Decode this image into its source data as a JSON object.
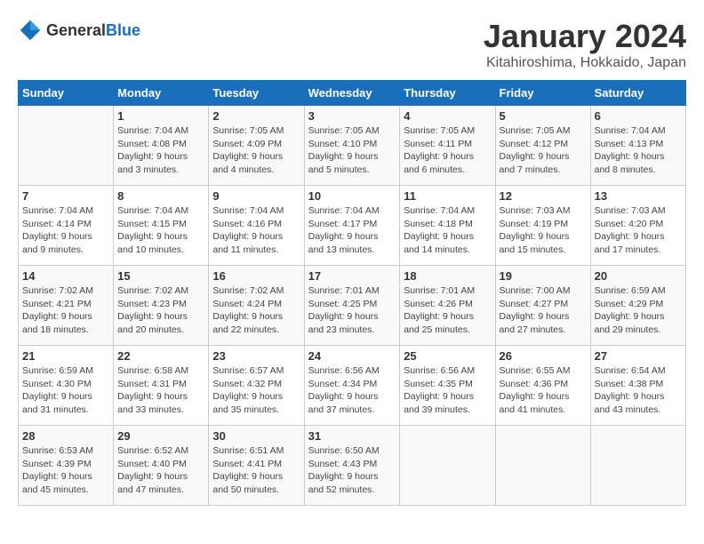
{
  "logo": {
    "general": "General",
    "blue": "Blue"
  },
  "header": {
    "month": "January 2024",
    "location": "Kitahiroshima, Hokkaido, Japan"
  },
  "weekdays": [
    "Sunday",
    "Monday",
    "Tuesday",
    "Wednesday",
    "Thursday",
    "Friday",
    "Saturday"
  ],
  "weeks": [
    [
      {
        "day": "",
        "sunrise": "",
        "sunset": "",
        "daylight": ""
      },
      {
        "day": "1",
        "sunrise": "Sunrise: 7:04 AM",
        "sunset": "Sunset: 4:08 PM",
        "daylight": "Daylight: 9 hours and 3 minutes."
      },
      {
        "day": "2",
        "sunrise": "Sunrise: 7:05 AM",
        "sunset": "Sunset: 4:09 PM",
        "daylight": "Daylight: 9 hours and 4 minutes."
      },
      {
        "day": "3",
        "sunrise": "Sunrise: 7:05 AM",
        "sunset": "Sunset: 4:10 PM",
        "daylight": "Daylight: 9 hours and 5 minutes."
      },
      {
        "day": "4",
        "sunrise": "Sunrise: 7:05 AM",
        "sunset": "Sunset: 4:11 PM",
        "daylight": "Daylight: 9 hours and 6 minutes."
      },
      {
        "day": "5",
        "sunrise": "Sunrise: 7:05 AM",
        "sunset": "Sunset: 4:12 PM",
        "daylight": "Daylight: 9 hours and 7 minutes."
      },
      {
        "day": "6",
        "sunrise": "Sunrise: 7:04 AM",
        "sunset": "Sunset: 4:13 PM",
        "daylight": "Daylight: 9 hours and 8 minutes."
      }
    ],
    [
      {
        "day": "7",
        "sunrise": "Sunrise: 7:04 AM",
        "sunset": "Sunset: 4:14 PM",
        "daylight": "Daylight: 9 hours and 9 minutes."
      },
      {
        "day": "8",
        "sunrise": "Sunrise: 7:04 AM",
        "sunset": "Sunset: 4:15 PM",
        "daylight": "Daylight: 9 hours and 10 minutes."
      },
      {
        "day": "9",
        "sunrise": "Sunrise: 7:04 AM",
        "sunset": "Sunset: 4:16 PM",
        "daylight": "Daylight: 9 hours and 11 minutes."
      },
      {
        "day": "10",
        "sunrise": "Sunrise: 7:04 AM",
        "sunset": "Sunset: 4:17 PM",
        "daylight": "Daylight: 9 hours and 13 minutes."
      },
      {
        "day": "11",
        "sunrise": "Sunrise: 7:04 AM",
        "sunset": "Sunset: 4:18 PM",
        "daylight": "Daylight: 9 hours and 14 minutes."
      },
      {
        "day": "12",
        "sunrise": "Sunrise: 7:03 AM",
        "sunset": "Sunset: 4:19 PM",
        "daylight": "Daylight: 9 hours and 15 minutes."
      },
      {
        "day": "13",
        "sunrise": "Sunrise: 7:03 AM",
        "sunset": "Sunset: 4:20 PM",
        "daylight": "Daylight: 9 hours and 17 minutes."
      }
    ],
    [
      {
        "day": "14",
        "sunrise": "Sunrise: 7:02 AM",
        "sunset": "Sunset: 4:21 PM",
        "daylight": "Daylight: 9 hours and 18 minutes."
      },
      {
        "day": "15",
        "sunrise": "Sunrise: 7:02 AM",
        "sunset": "Sunset: 4:23 PM",
        "daylight": "Daylight: 9 hours and 20 minutes."
      },
      {
        "day": "16",
        "sunrise": "Sunrise: 7:02 AM",
        "sunset": "Sunset: 4:24 PM",
        "daylight": "Daylight: 9 hours and 22 minutes."
      },
      {
        "day": "17",
        "sunrise": "Sunrise: 7:01 AM",
        "sunset": "Sunset: 4:25 PM",
        "daylight": "Daylight: 9 hours and 23 minutes."
      },
      {
        "day": "18",
        "sunrise": "Sunrise: 7:01 AM",
        "sunset": "Sunset: 4:26 PM",
        "daylight": "Daylight: 9 hours and 25 minutes."
      },
      {
        "day": "19",
        "sunrise": "Sunrise: 7:00 AM",
        "sunset": "Sunset: 4:27 PM",
        "daylight": "Daylight: 9 hours and 27 minutes."
      },
      {
        "day": "20",
        "sunrise": "Sunrise: 6:59 AM",
        "sunset": "Sunset: 4:29 PM",
        "daylight": "Daylight: 9 hours and 29 minutes."
      }
    ],
    [
      {
        "day": "21",
        "sunrise": "Sunrise: 6:59 AM",
        "sunset": "Sunset: 4:30 PM",
        "daylight": "Daylight: 9 hours and 31 minutes."
      },
      {
        "day": "22",
        "sunrise": "Sunrise: 6:58 AM",
        "sunset": "Sunset: 4:31 PM",
        "daylight": "Daylight: 9 hours and 33 minutes."
      },
      {
        "day": "23",
        "sunrise": "Sunrise: 6:57 AM",
        "sunset": "Sunset: 4:32 PM",
        "daylight": "Daylight: 9 hours and 35 minutes."
      },
      {
        "day": "24",
        "sunrise": "Sunrise: 6:56 AM",
        "sunset": "Sunset: 4:34 PM",
        "daylight": "Daylight: 9 hours and 37 minutes."
      },
      {
        "day": "25",
        "sunrise": "Sunrise: 6:56 AM",
        "sunset": "Sunset: 4:35 PM",
        "daylight": "Daylight: 9 hours and 39 minutes."
      },
      {
        "day": "26",
        "sunrise": "Sunrise: 6:55 AM",
        "sunset": "Sunset: 4:36 PM",
        "daylight": "Daylight: 9 hours and 41 minutes."
      },
      {
        "day": "27",
        "sunrise": "Sunrise: 6:54 AM",
        "sunset": "Sunset: 4:38 PM",
        "daylight": "Daylight: 9 hours and 43 minutes."
      }
    ],
    [
      {
        "day": "28",
        "sunrise": "Sunrise: 6:53 AM",
        "sunset": "Sunset: 4:39 PM",
        "daylight": "Daylight: 9 hours and 45 minutes."
      },
      {
        "day": "29",
        "sunrise": "Sunrise: 6:52 AM",
        "sunset": "Sunset: 4:40 PM",
        "daylight": "Daylight: 9 hours and 47 minutes."
      },
      {
        "day": "30",
        "sunrise": "Sunrise: 6:51 AM",
        "sunset": "Sunset: 4:41 PM",
        "daylight": "Daylight: 9 hours and 50 minutes."
      },
      {
        "day": "31",
        "sunrise": "Sunrise: 6:50 AM",
        "sunset": "Sunset: 4:43 PM",
        "daylight": "Daylight: 9 hours and 52 minutes."
      },
      {
        "day": "",
        "sunrise": "",
        "sunset": "",
        "daylight": ""
      },
      {
        "day": "",
        "sunrise": "",
        "sunset": "",
        "daylight": ""
      },
      {
        "day": "",
        "sunrise": "",
        "sunset": "",
        "daylight": ""
      }
    ]
  ]
}
